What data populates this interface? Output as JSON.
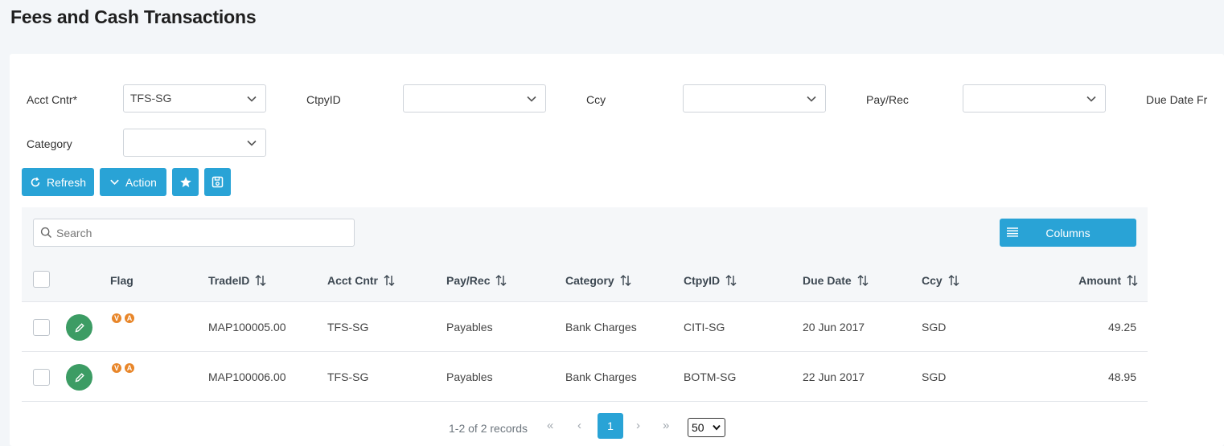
{
  "page": {
    "title": "Fees and Cash Transactions"
  },
  "filters": {
    "acct_cntr": {
      "label": "Acct Cntr*",
      "value": "TFS-SG"
    },
    "ctpy_id": {
      "label": "CtpyID",
      "value": ""
    },
    "ccy": {
      "label": "Ccy",
      "value": ""
    },
    "pay_rec": {
      "label": "Pay/Rec",
      "value": ""
    },
    "due_date_from": {
      "label": "Due Date Fr"
    },
    "category": {
      "label": "Category",
      "value": ""
    }
  },
  "toolbar": {
    "refresh_label": "Refresh",
    "action_label": "Action",
    "favorite_icon": "star-icon",
    "save_icon": "save-icon"
  },
  "grid": {
    "search": {
      "placeholder": "Search",
      "value": ""
    },
    "columns_label": "Columns",
    "headers": {
      "flag": "Flag",
      "trade_id": "TradeID",
      "acct_cntr": "Acct Cntr",
      "pay_rec": "Pay/Rec",
      "category": "Category",
      "ctpy_id": "CtpyID",
      "due_date": "Due Date",
      "ccy": "Ccy",
      "amount": "Amount"
    },
    "rows": [
      {
        "flags": [
          "V",
          "A"
        ],
        "trade_id": "MAP100005.00",
        "acct_cntr": "TFS-SG",
        "pay_rec": "Payables",
        "category": "Bank Charges",
        "ctpy_id": "CITI-SG",
        "due_date": "20 Jun 2017",
        "ccy": "SGD",
        "amount": "49.25"
      },
      {
        "flags": [
          "V",
          "A"
        ],
        "trade_id": "MAP100006.00",
        "acct_cntr": "TFS-SG",
        "pay_rec": "Payables",
        "category": "Bank Charges",
        "ctpy_id": "BOTM-SG",
        "due_date": "22 Jun 2017",
        "ccy": "SGD",
        "amount": "48.95"
      }
    ]
  },
  "pagination": {
    "info": "1-2 of 2 records",
    "first": "«",
    "prev": "‹",
    "next": "›",
    "last": "»",
    "current_page": "1",
    "page_size": "50"
  },
  "colors": {
    "accent": "#29a3d6",
    "edit": "#3c9c64",
    "flag": "#e8862a"
  }
}
